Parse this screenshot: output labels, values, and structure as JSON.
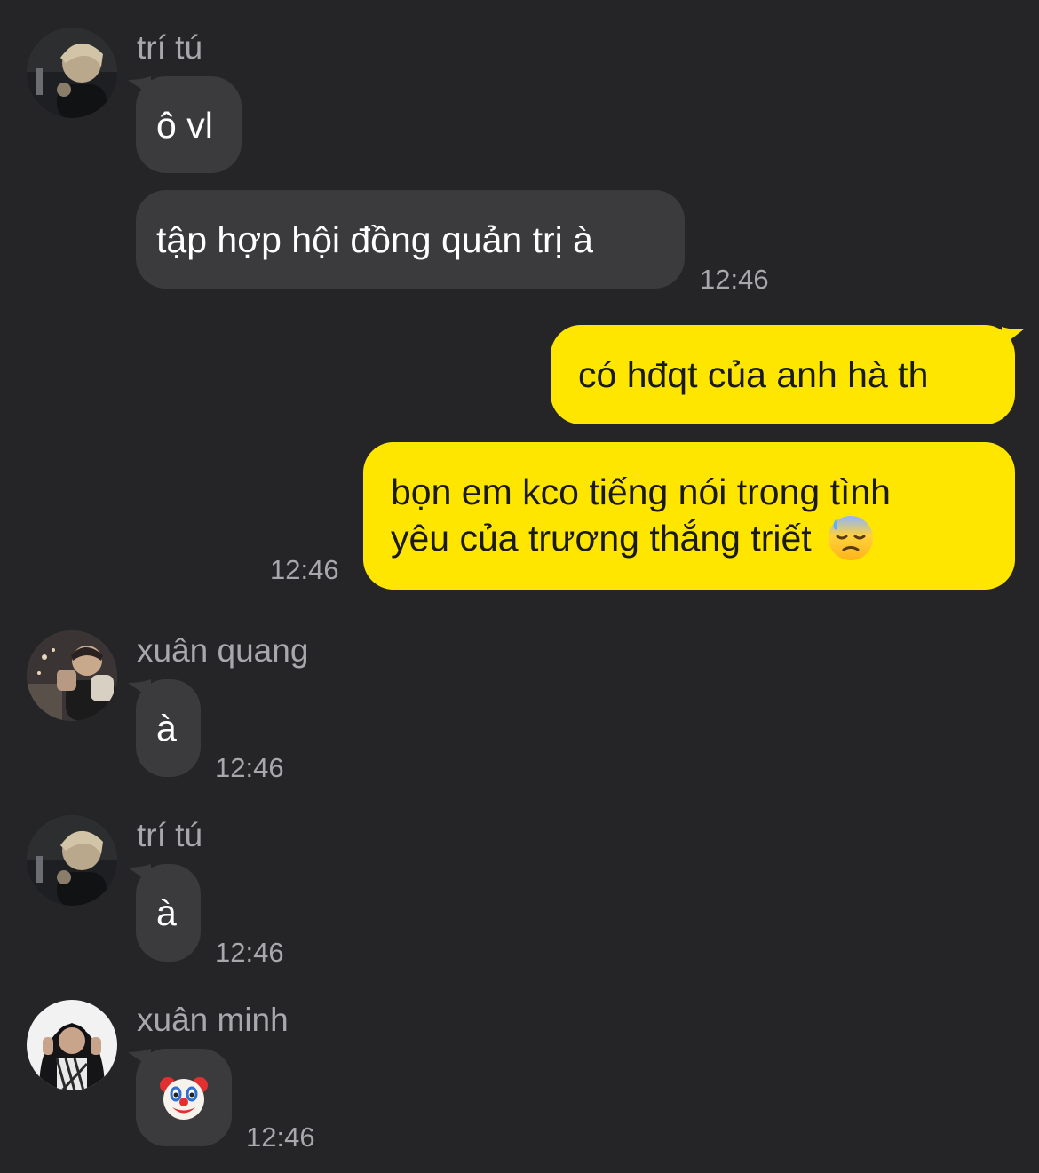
{
  "messages": {
    "m1": {
      "sender": "trí tú",
      "text1": "ô vl",
      "text2": "tập hợp hội đồng quản trị à",
      "time": "12:46"
    },
    "m2": {
      "text1": "có hđqt của anh hà th",
      "text2_line1": "bọn em kco tiếng nói trong tình",
      "text2_line2": "yêu của trương thắng triết",
      "time": "12:46"
    },
    "m3": {
      "sender": "xuân quang",
      "text": "à",
      "time": "12:46"
    },
    "m4": {
      "sender": "trí tú",
      "text": "à",
      "time": "12:46"
    },
    "m5": {
      "sender": "xuân minh",
      "emoji": "clown-face",
      "time": "12:46"
    }
  },
  "icons": {
    "sweat_emoji": "downcast-face-with-sweat",
    "clown_emoji": "clown-face"
  },
  "colors": {
    "background": "#252527",
    "incoming_bubble": "#3b3b3d",
    "outgoing_bubble": "#ffe600",
    "secondary_text": "#a8a8ac"
  }
}
